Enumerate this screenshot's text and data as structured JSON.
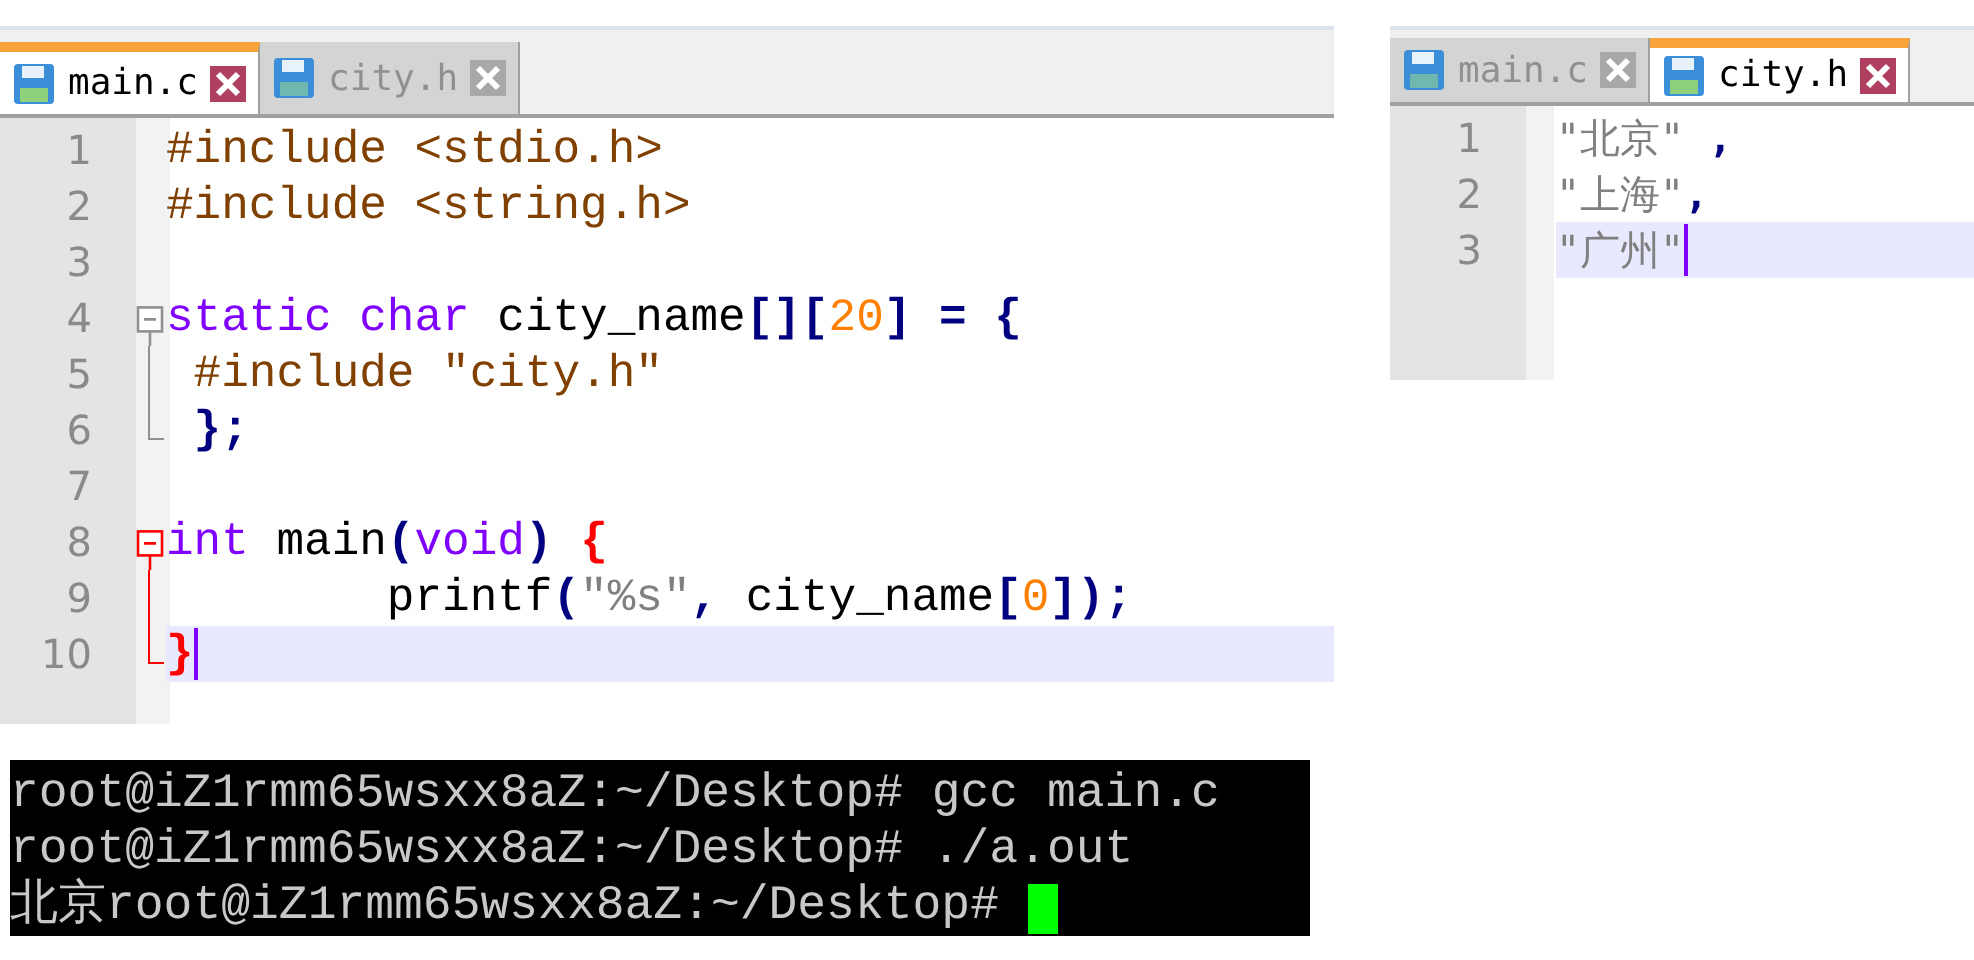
{
  "editors": [
    {
      "tabs": [
        {
          "label": "main.c",
          "selected": true
        },
        {
          "label": "city.h",
          "selected": false
        }
      ],
      "lines": [
        {
          "number": "1",
          "current": false,
          "kind": "plain",
          "tokens": [
            {
              "kind": "preprocessor",
              "text": "#include <stdio.h>"
            }
          ]
        },
        {
          "number": "2",
          "current": false,
          "kind": "plain",
          "tokens": [
            {
              "kind": "preprocessor",
              "text": "#include <string.h>"
            }
          ]
        },
        {
          "number": "3",
          "current": false,
          "kind": "plain"
        },
        {
          "number": "4",
          "current": false,
          "kind": "fold_start",
          "fold_active": false,
          "tokens": [
            {
              "kind": "keyword",
              "text": "static char "
            },
            {
              "kind": "identifier",
              "text": "city_name"
            },
            {
              "kind": "operator",
              "text": "[]["
            },
            {
              "kind": "number",
              "text": "20"
            },
            {
              "kind": "operator",
              "text": "] = {"
            }
          ]
        },
        {
          "number": "5",
          "current": false,
          "kind": "fold_body",
          "fold_active": false,
          "tokens": [
            {
              "kind": "preprocessor",
              "text": " #include \"city.h\""
            }
          ]
        },
        {
          "number": "6",
          "current": false,
          "kind": "fold_end",
          "fold_active": false,
          "tokens": [
            {
              "kind": "operator",
              "text": " };"
            }
          ]
        },
        {
          "number": "7",
          "current": false,
          "kind": "plain"
        },
        {
          "number": "8",
          "current": false,
          "kind": "fold_start",
          "fold_active": true,
          "tokens": [
            {
              "kind": "keyword",
              "text": "int "
            },
            {
              "kind": "identifier",
              "text": "main"
            },
            {
              "kind": "operator",
              "text": "("
            },
            {
              "kind": "keyword",
              "text": "void"
            },
            {
              "kind": "operator",
              "text": ") "
            },
            {
              "kind": "brace",
              "text": "{"
            }
          ]
        },
        {
          "number": "9",
          "current": false,
          "kind": "fold_body",
          "fold_active": true,
          "tokens": [
            {
              "kind": "identifier",
              "text": "        printf"
            },
            {
              "kind": "operator",
              "text": "("
            },
            {
              "kind": "string",
              "text": "\"%s\""
            },
            {
              "kind": "operator",
              "text": ", "
            },
            {
              "kind": "identifier",
              "text": "city_name"
            },
            {
              "kind": "operator",
              "text": "["
            },
            {
              "kind": "number",
              "text": "0"
            },
            {
              "kind": "operator",
              "text": "]);"
            }
          ]
        },
        {
          "number": "10",
          "current": true,
          "kind": "fold_end",
          "fold_active": true,
          "tokens": [
            {
              "kind": "brace",
              "text": "}"
            }
          ]
        }
      ]
    },
    {
      "tabs": [
        {
          "label": "main.c",
          "selected": false
        },
        {
          "label": "city.h",
          "selected": true
        }
      ],
      "lines": [
        {
          "number": "1",
          "current": false,
          "kind": "plain",
          "tokens": [
            {
              "kind": "string",
              "text": "\"北京\" "
            },
            {
              "kind": "operator",
              "text": ","
            }
          ]
        },
        {
          "number": "2",
          "current": false,
          "kind": "plain",
          "tokens": [
            {
              "kind": "string",
              "text": "\"上海\""
            },
            {
              "kind": "operator",
              "text": ","
            }
          ]
        },
        {
          "number": "3",
          "current": true,
          "kind": "plain",
          "tokens": [
            {
              "kind": "string",
              "text": "\"广州\""
            }
          ]
        }
      ]
    }
  ],
  "terminal": {
    "cursor": true,
    "lines": [
      {
        "prompt": "root@iZ1rmm65wsxx8aZ:~/Desktop# ",
        "command": "gcc main.c"
      },
      {
        "prompt": "root@iZ1rmm65wsxx8aZ:~/Desktop# ",
        "command": "./a.out"
      },
      {
        "output": "北京",
        "prompt": "root@iZ1rmm65wsxx8aZ:~/Desktop# "
      }
    ]
  }
}
